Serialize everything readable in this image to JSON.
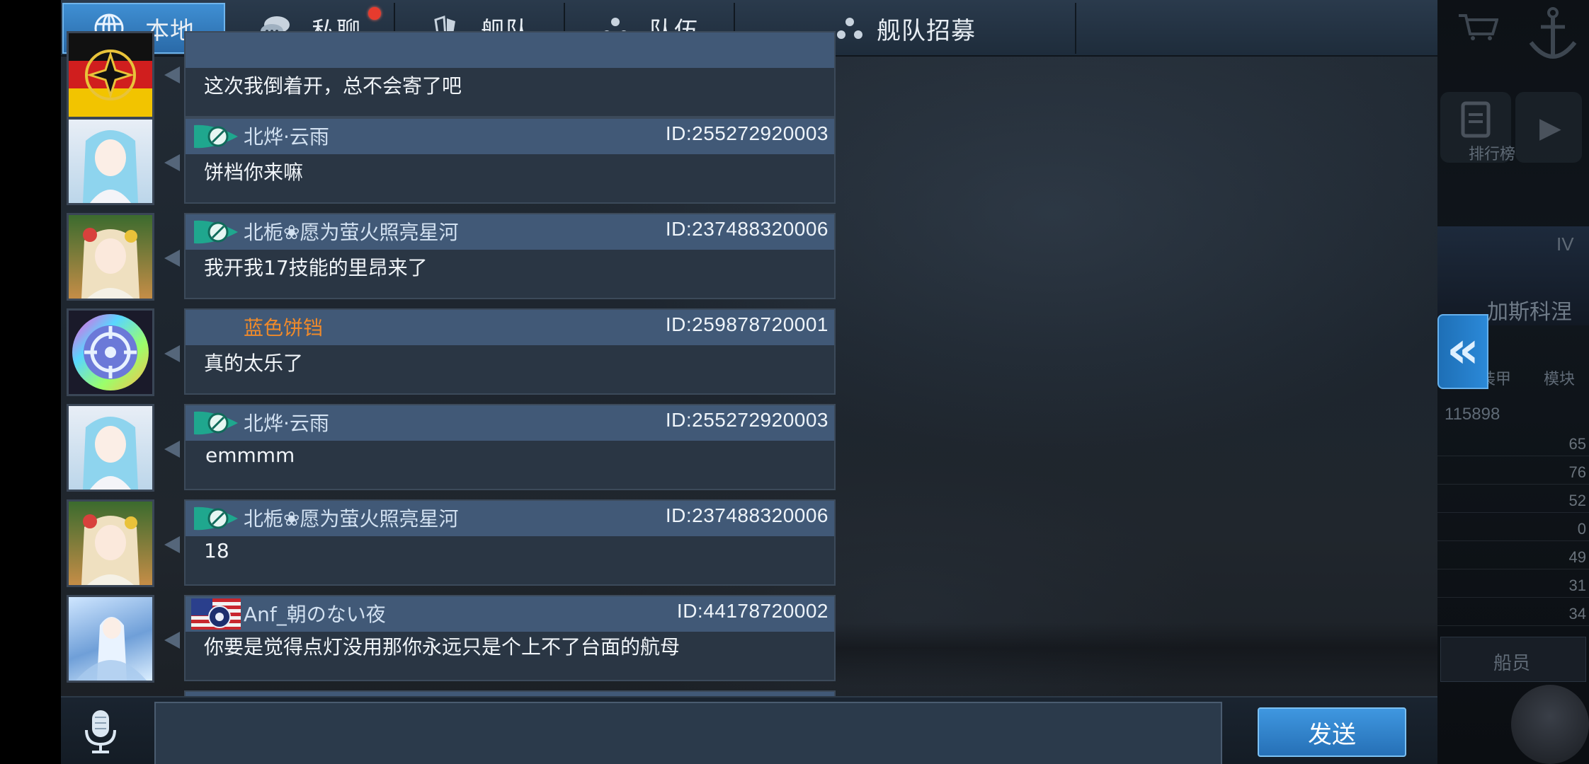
{
  "tabs": [
    {
      "label": "本地",
      "icon": "globe-icon",
      "active": true
    },
    {
      "label": "私聊",
      "icon": "chat-bubble-icon",
      "active": false,
      "notification": true
    },
    {
      "label": "舰队",
      "icon": "fleet-icon",
      "active": false
    },
    {
      "label": "队伍",
      "icon": "team-icon",
      "active": false
    },
    {
      "label": "舰队招募",
      "icon": "team-icon",
      "active": false
    }
  ],
  "messages": [
    {
      "avatar": "iron-cross-avatar",
      "name": "",
      "uid": "",
      "text": "这次我倒着开，总不会寄了吧",
      "badge": "none"
    },
    {
      "avatar": "blue-hair-girl-avatar",
      "name": "北烨·云雨",
      "uid": "ID:255272920003",
      "text": "饼档你来嘛",
      "badge": "guild"
    },
    {
      "avatar": "flower-girl-avatar",
      "name": "北栀❀愿为萤火照亮星河",
      "uid": "ID:237488320006",
      "text": "我开我17技能的里昂来了",
      "badge": "guild"
    },
    {
      "avatar": "rainbow-emblem-avatar",
      "name": "蓝色饼铛",
      "uid": "ID:259878720001",
      "text": "真的太乐了",
      "badge": "none",
      "name_color": "#f08a2a"
    },
    {
      "avatar": "blue-hair-girl-avatar",
      "name": "北烨·云雨",
      "uid": "ID:255272920003",
      "text": "emmmm",
      "badge": "guild"
    },
    {
      "avatar": "flower-girl-avatar",
      "name": "北栀❀愿为萤火照亮星河",
      "uid": "ID:237488320006",
      "text": "18",
      "badge": "guild"
    },
    {
      "avatar": "ice-girl-avatar",
      "name": "Anf_朝のない夜",
      "uid": "ID:44178720002",
      "text": "你要是觉得点灯没用那你永远只是个上不了台面的航母",
      "badge": "us-flag"
    }
  ],
  "input": {
    "placeholder": "",
    "value": ""
  },
  "send_label": "发送",
  "side_panel": {
    "rank_label": "排行榜",
    "tier": "IV",
    "ship_name": "加斯科涅",
    "armor_label": "装甲",
    "module_label": "模块",
    "power": "115898",
    "stats": [
      "65",
      "76",
      "52",
      "0",
      "49",
      "31",
      "34"
    ],
    "crew_label": "船员"
  },
  "colors": {
    "accent": "#3f8fd3",
    "bubble_header": "#415977",
    "bubble_body": "#2a3644",
    "notify": "#e63b2e",
    "orange_name": "#f08a2a"
  }
}
